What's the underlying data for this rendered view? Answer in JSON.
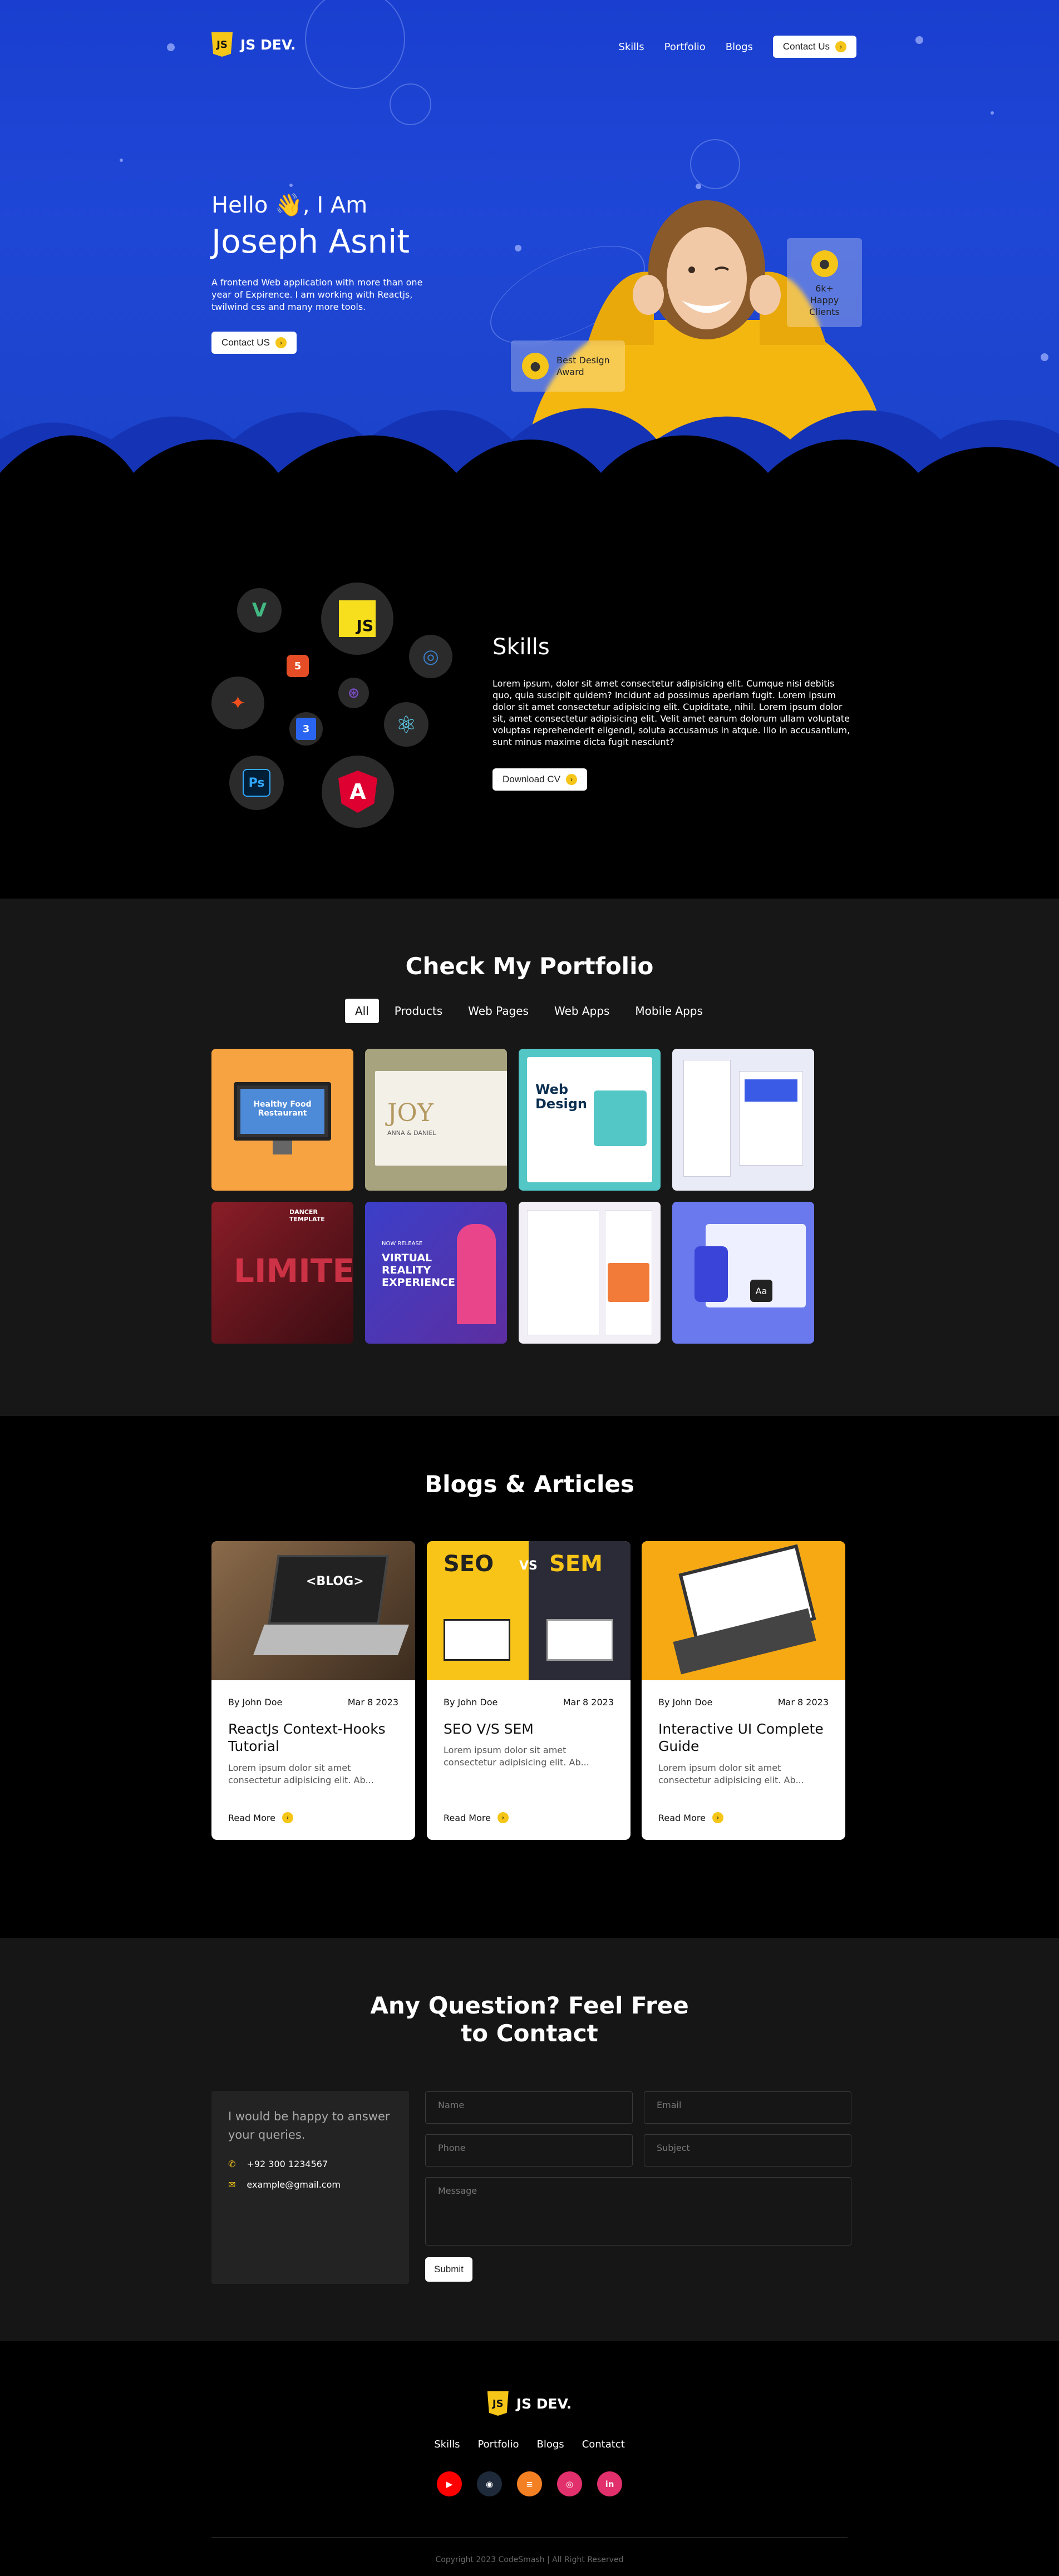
{
  "header": {
    "logo_mark": "JS",
    "logo_text": "JS DEV.",
    "nav": [
      "Skills",
      "Portfolio",
      "Blogs"
    ],
    "contact_button": "Contact Us"
  },
  "hero": {
    "greeting": "Hello 👋, I Am",
    "name": "Joseph Asnit",
    "intro": "A frontend Web application with more than one year of Expirence. I am working with Reactjs, twilwind css and many more tools.",
    "button": "Contact US",
    "badge_clients": "6k+ Happy Clients",
    "badge_award": "Best Design Award",
    "image_description_icon": "smiling-woman-yellow-hoodie"
  },
  "skills": {
    "title": "Skills",
    "text": "Lorem ipsum, dolor sit amet consectetur adipisicing elit. Cumque nisi debitis quo, quia suscipit quidem? Incidunt ad possimus aperiam fugit. Lorem ipsum dolor sit amet consectetur adipisicing elit. Cupiditate, nihil. Lorem ipsum dolor sit, amet consectetur adipisicing elit. Velit amet earum dolorum ullam voluptate voluptas reprehenderit eligendi, soluta accusamus in atque. Illo in accusantium, sunt minus maxime dicta fugit nesciunt?",
    "button": "Download CV",
    "icons": {
      "vue": "V",
      "js": "JS",
      "html": "5",
      "jquery": "◎",
      "figma": "✦",
      "redux": "⊛",
      "css": "3",
      "react": "⚛",
      "ps": "Ps",
      "angular": "A"
    }
  },
  "portfolio": {
    "title": "Check My Portfolio",
    "tabs": [
      "All",
      "Products",
      "Web Pages",
      "Web Apps",
      "Mobile Apps"
    ],
    "active_tab": "All",
    "items": [
      {
        "text": "Healthy Food Restaurant",
        "bg": "#f7a341"
      },
      {
        "text": "JOY",
        "sub": "ANNA & DANIEL",
        "bg": "#a7a37f"
      },
      {
        "text": "Web Design",
        "bg": "#53c6c6"
      },
      {
        "text": "",
        "bg": "#e9ebf7"
      },
      {
        "text": "LIMITE",
        "sub": "DANCER TEMPLATE",
        "bg": "#7b1a24"
      },
      {
        "text": "VIRTUAL REALITY EXPERIENCE",
        "sub": "NOW RELEASE",
        "bg": "#4b4fd6"
      },
      {
        "text": "",
        "bg": "#f2f0f6"
      },
      {
        "text": "Aa",
        "bg": "#6a79ee"
      }
    ]
  },
  "blogs": {
    "title": "Blogs & Articles",
    "posts": [
      {
        "author": "By John Doe",
        "date": "Mar 8 2023",
        "title": "ReactJs Context-Hooks Tutorial",
        "desc": "Lorem ipsum dolor sit amet consectetur adipisicing elit. Ab...",
        "read": "Read More",
        "img_text": "<BLOG>"
      },
      {
        "author": "By John Doe",
        "date": "Mar 8 2023",
        "title": "SEO V/S SEM",
        "desc": "Lorem ipsum dolor sit amet consectetur adipisicing elit. Ab...",
        "read": "Read More",
        "img_left": "SEO",
        "img_vs": "VS",
        "img_right": "SEM"
      },
      {
        "author": "By John Doe",
        "date": "Mar 8 2023",
        "title": "Interactive UI Complete Guide",
        "desc": "Lorem ipsum dolor sit amet consectetur adipisicing elit. Ab...",
        "read": "Read More"
      }
    ]
  },
  "contact": {
    "title_line1": "Any Question? Feel Free",
    "title_line2": "to Contact",
    "info_text": "I would be happy to answer your queries.",
    "phone": "+92 300 1234567",
    "email": "example@gmail.com",
    "placeholders": {
      "name": "Name",
      "email": "Email",
      "phone": "Phone",
      "subject": "Subject",
      "message": "Message"
    },
    "submit": "Submit"
  },
  "footer": {
    "logo_text": "JS DEV.",
    "nav": [
      "Skills",
      "Portfolio",
      "Blogs",
      "Contatct"
    ],
    "socials": [
      {
        "name": "youtube",
        "glyph": "▶",
        "color": "#ff0000"
      },
      {
        "name": "github",
        "glyph": "◉",
        "color": "#1e2a3a"
      },
      {
        "name": "stackoverflow",
        "glyph": "≡",
        "color": "#f48024"
      },
      {
        "name": "instagram",
        "glyph": "◎",
        "color": "#e1306c"
      },
      {
        "name": "linkedin",
        "glyph": "in",
        "color": "#e1306c"
      }
    ],
    "copyright": "Copyright 2023 CodeSmash | All Right Reserved"
  }
}
